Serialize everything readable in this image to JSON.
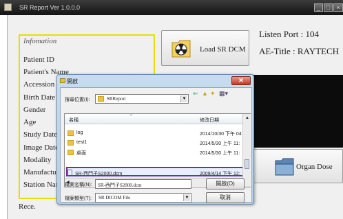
{
  "titlebar": {
    "title": "SR Report  Ver 1.0.0.0"
  },
  "info": {
    "header": "Infomation",
    "labels": [
      "Patient ID",
      "Patient's Name",
      "Accession",
      "Birth Date",
      "Gender",
      "Age",
      "Study Date",
      "Image Date",
      "Modality",
      "Manufactur",
      "Station Nam"
    ]
  },
  "buttons": {
    "load_sr": "Load SR DCM",
    "organ_dose": "Organ Dose"
  },
  "listen": {
    "port": "Listen Port : 104",
    "ae_title": "AE-Title : RAYTECH"
  },
  "footer": {
    "rece": "Rece."
  },
  "dialog": {
    "title": "開啟",
    "look_in_label": "搜尋位置(I):",
    "look_in_value": "SRReport",
    "col_name": "名稱",
    "col_date": "修改日期",
    "rows": [
      {
        "name": "log",
        "date": "2014/10/30 下午 04",
        "type": "folder"
      },
      {
        "name": "test1",
        "date": "2014/5/30 上午 11:",
        "type": "folder"
      },
      {
        "name": "桌面",
        "date": "2014/5/30 上午 11:",
        "type": "folder"
      },
      {
        "name": "SR-西門子S2000.dcm",
        "date": "2009/4/14 下午 12:",
        "type": "file"
      }
    ],
    "filename_label": "檔案名稱(N):",
    "filename_value": "SR-西門子S2000.dcm",
    "filetype_label": "檔案類型(T):",
    "filetype_value": "SR DICOM File",
    "open_button": "開啟(O)",
    "cancel_button": "取消"
  }
}
